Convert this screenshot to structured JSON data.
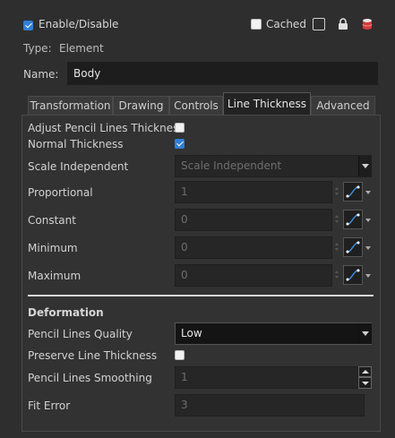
{
  "header": {
    "enable_label": "Enable/Disable",
    "enable_checked": true,
    "cached_label": "Cached",
    "cached_checked": false,
    "type_label": "Type:",
    "type_value": "Element",
    "name_label": "Name:",
    "name_value": "Body"
  },
  "tabs": [
    {
      "label": "Transformation",
      "selected": false
    },
    {
      "label": "Drawing",
      "selected": false
    },
    {
      "label": "Controls",
      "selected": false
    },
    {
      "label": "Line Thickness",
      "selected": true
    },
    {
      "label": "Advanced",
      "selected": false
    }
  ],
  "line_thickness": {
    "adjust_label": "Adjust Pencil Lines Thickness",
    "adjust_checked": false,
    "normal_label": "Normal Thickness",
    "normal_checked": true,
    "scale_label": "Scale Independent",
    "scale_value": "Scale Independent",
    "proportional_label": "Proportional",
    "proportional_value": "1",
    "constant_label": "Constant",
    "constant_value": "0",
    "minimum_label": "Minimum",
    "minimum_value": "0",
    "maximum_label": "Maximum",
    "maximum_value": "0"
  },
  "deformation": {
    "section_label": "Deformation",
    "quality_label": "Pencil Lines Quality",
    "quality_value": "Low",
    "preserve_label": "Preserve Line Thickness",
    "preserve_checked": false,
    "smoothing_label": "Pencil Lines Smoothing",
    "smoothing_value": "1",
    "fit_error_label": "Fit Error",
    "fit_error_value": "3"
  },
  "colors": {
    "background": "#2e2e2e",
    "checkbox_accent": "#2f7fd6",
    "function_curve": "#3d8bd9"
  },
  "icons": [
    "checkmark-icon",
    "cached-swatch-icon",
    "lock-icon",
    "database-icon",
    "function-curve-icon",
    "dropdown-arrow-icon",
    "spin-up-icon",
    "spin-down-icon"
  ]
}
